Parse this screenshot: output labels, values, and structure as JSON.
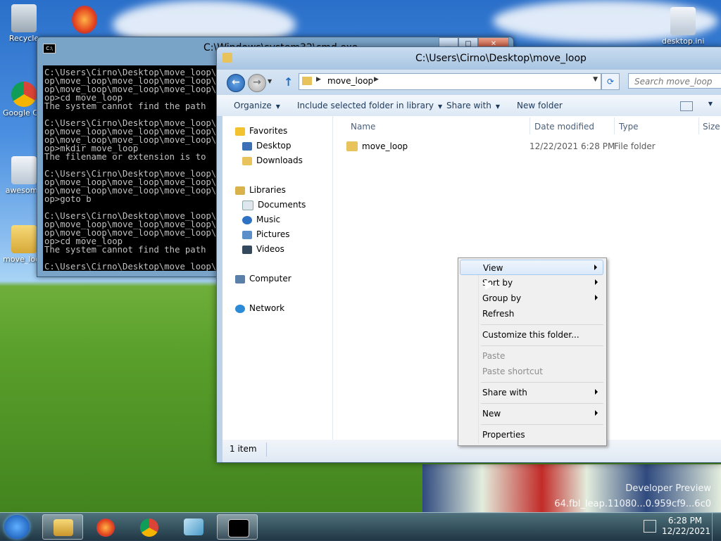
{
  "desktop": {
    "icons": [
      {
        "label": "Recycle",
        "icon": "recycle-bin-icon"
      },
      {
        "label": "Google Chrome",
        "icon": "chrome-icon"
      },
      {
        "label": "awesome",
        "icon": "settings-file-icon"
      },
      {
        "label": "move_loop",
        "icon": "folder-icon"
      },
      {
        "label": "desktop.ini",
        "icon": "settings-file-icon"
      }
    ],
    "watermark": {
      "line1": "Developer Preview",
      "line2": "64.fbl_leap.11080...0.959cf9...6c0"
    }
  },
  "cmd": {
    "title": "C:\\Windows\\system32\\cmd.exe",
    "lines": [
      "C:\\Users\\Cirno\\Desktop\\move_loop\\move_lo",
      "op\\move_loop\\move_loop\\move_loop\\move_lo",
      "op\\move_loop\\move_loop\\move_loop\\move_lo",
      "op>cd move_loop",
      "The system cannot find the path",
      "",
      "C:\\Users\\Cirno\\Desktop\\move_loop\\move_lo",
      "op\\move_loop\\move_loop\\move_loop\\move_lo",
      "op\\move_loop\\move_loop\\move_loop\\move_lo",
      "op>mkdir move_loop",
      "The filename or extension is to",
      "",
      "C:\\Users\\Cirno\\Desktop\\move_loop\\move_lo",
      "op\\move_loop\\move_loop\\move_loop\\move_lo",
      "op\\move_loop\\move_loop\\move_loop\\move_lo",
      "op>goto b",
      "",
      "C:\\Users\\Cirno\\Desktop\\move_loop\\move_lo",
      "op\\move_loop\\move_loop\\move_loop\\move_lo",
      "op\\move_loop\\move_loop\\move_loop\\move_lo",
      "op>cd move_loop",
      "The system cannot find the path",
      "",
      "C:\\Users\\Cirno\\Desktop\\move_loop\\move_lo"
    ]
  },
  "explorer": {
    "title": "C:\\Users\\Cirno\\Desktop\\move_loop",
    "path_segment": "move_loop",
    "search_placeholder": "Search move_loop",
    "toolbar": {
      "organize": "Organize",
      "include": "Include selected folder in library",
      "share": "Share with",
      "new_folder": "New folder"
    },
    "nav": {
      "favorites": "Favorites",
      "desktop": "Desktop",
      "downloads": "Downloads",
      "libraries": "Libraries",
      "documents": "Documents",
      "music": "Music",
      "pictures": "Pictures",
      "videos": "Videos",
      "computer": "Computer",
      "network": "Network"
    },
    "columns": {
      "name": "Name",
      "date": "Date modified",
      "type": "Type",
      "size": "Size"
    },
    "files": [
      {
        "name": "move_loop",
        "date": "12/22/2021 6:28 PM",
        "type": "File folder"
      }
    ],
    "status": "1 item"
  },
  "context_menu": {
    "view": "View",
    "sort_by": "Sort by",
    "group_by": "Group by",
    "refresh": "Refresh",
    "customize": "Customize this folder...",
    "paste": "Paste",
    "paste_shortcut": "Paste shortcut",
    "share_with": "Share with",
    "new": "New",
    "properties": "Properties"
  },
  "taskbar": {
    "clock_time": "6:28 PM",
    "clock_date": "12/22/2021"
  },
  "colors": {
    "console_bg": "#000000",
    "console_fg": "#c0c0c0",
    "menu_highlight": "#dbe9f9",
    "folder": "#e8c25a"
  }
}
